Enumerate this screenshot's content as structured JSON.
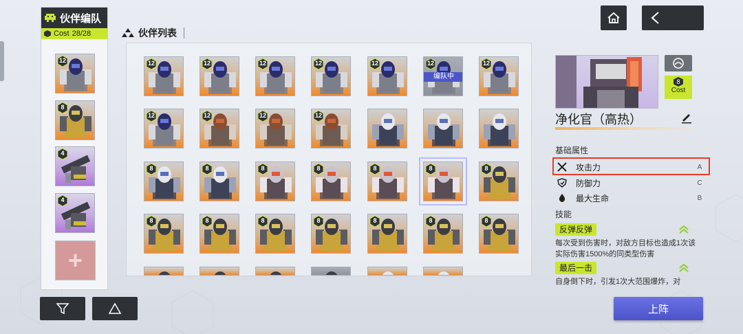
{
  "team": {
    "title": "伙伴编队",
    "cost_label": "Cost",
    "cost_value": "28/28",
    "slots": [
      {
        "level": "12",
        "bg": "orange",
        "mech": "blue"
      },
      {
        "level": "8",
        "bg": "orange",
        "mech": "yellow"
      },
      {
        "level": "4",
        "bg": "purple",
        "mech": "gun"
      },
      {
        "level": "4",
        "bg": "purple",
        "mech": "gun"
      }
    ]
  },
  "list": {
    "title": "伙伴列表",
    "in_team_label": "编队中",
    "cards": [
      {
        "level": "12",
        "bg": "orange",
        "mech": "blue"
      },
      {
        "level": "12",
        "bg": "orange",
        "mech": "blue"
      },
      {
        "level": "12",
        "bg": "orange",
        "mech": "blue"
      },
      {
        "level": "12",
        "bg": "orange",
        "mech": "blue"
      },
      {
        "level": "12",
        "bg": "orange",
        "mech": "blue"
      },
      {
        "level": "12",
        "bg": "gray",
        "mech": "blue",
        "in_team": true
      },
      {
        "level": "12",
        "bg": "orange",
        "mech": "blue"
      },
      {
        "level": "12",
        "bg": "orange",
        "mech": "blue"
      },
      {
        "level": "12",
        "bg": "orange",
        "mech": "brown"
      },
      {
        "level": "12",
        "bg": "orange",
        "mech": "brown"
      },
      {
        "level": "12",
        "bg": "orange",
        "mech": "brown"
      },
      {
        "level": "",
        "bg": "orange",
        "mech": "white"
      },
      {
        "level": "",
        "bg": "orange",
        "mech": "white"
      },
      {
        "level": "",
        "bg": "orange",
        "mech": "white"
      },
      {
        "level": "8",
        "bg": "orange",
        "mech": "white"
      },
      {
        "level": "8",
        "bg": "orange",
        "mech": "white"
      },
      {
        "level": "8",
        "bg": "orange",
        "mech": "red"
      },
      {
        "level": "8",
        "bg": "orange",
        "mech": "red"
      },
      {
        "level": "8",
        "bg": "orange",
        "mech": "red"
      },
      {
        "level": "8",
        "bg": "orange",
        "mech": "red",
        "selected": true
      },
      {
        "level": "8",
        "bg": "orange",
        "mech": "yellow"
      },
      {
        "level": "8",
        "bg": "orange",
        "mech": "yellow"
      },
      {
        "level": "8",
        "bg": "orange",
        "mech": "yellow"
      },
      {
        "level": "8",
        "bg": "orange",
        "mech": "yellow"
      },
      {
        "level": "8",
        "bg": "orange",
        "mech": "yellow"
      },
      {
        "level": "8",
        "bg": "orange",
        "mech": "yellow"
      },
      {
        "level": "8",
        "bg": "orange",
        "mech": "yellow"
      },
      {
        "level": "8",
        "bg": "orange",
        "mech": "yellow"
      },
      {
        "level": "",
        "bg": "orange",
        "mech": "yellow"
      },
      {
        "level": "",
        "bg": "orange",
        "mech": "yellow"
      },
      {
        "level": "",
        "bg": "orange",
        "mech": "yellow"
      },
      {
        "level": "",
        "bg": "gray",
        "mech": "yellow"
      },
      {
        "level": "",
        "bg": "orange",
        "mech": "white"
      },
      {
        "level": "",
        "bg": "orange",
        "mech": "white"
      }
    ]
  },
  "detail": {
    "name": "净化官（高热）",
    "cost_value": "8",
    "cost_label": "Cost",
    "attributes_title": "基础属性",
    "attributes": [
      {
        "icon": "swords-icon",
        "label": "攻击力",
        "grade": "A"
      },
      {
        "icon": "shield-icon",
        "label": "防御力",
        "grade": "C"
      },
      {
        "icon": "drop-icon",
        "label": "最大生命",
        "grade": "B"
      }
    ],
    "skills_title": "技能",
    "skills": [
      {
        "name": "反弹反弹",
        "desc": "每次受到伤害时，对敌方目标也造成1次该实际伤害1500%的同类型伤害"
      },
      {
        "name": "最后一击",
        "desc": "自身倒下时，引发1次大范围爆炸，对"
      }
    ]
  },
  "buttons": {
    "deploy": "上阵"
  }
}
